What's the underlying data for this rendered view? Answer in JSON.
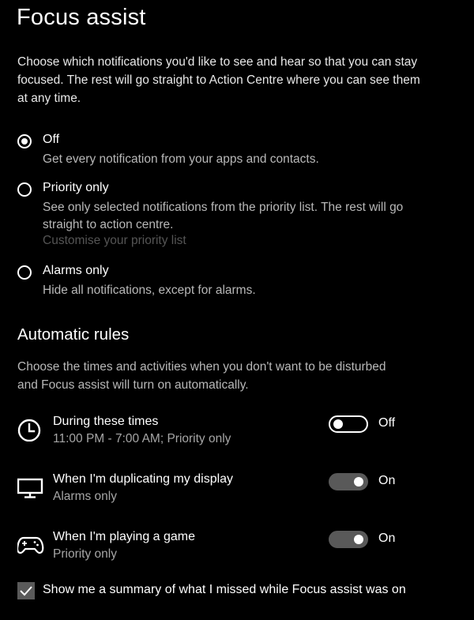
{
  "page": {
    "title": "Focus assist",
    "intro": "Choose which notifications you'd like to see and hear so that you can stay focused. The rest will go straight to Action Centre where you can see them at any time."
  },
  "modes": [
    {
      "label": "Off",
      "description": "Get every notification from your apps and contacts.",
      "selected": true
    },
    {
      "label": "Priority only",
      "description": "See only selected notifications from the priority list. The rest will go straight to action centre.",
      "link": "Customise your priority list",
      "selected": false
    },
    {
      "label": "Alarms only",
      "description": "Hide all notifications, except for alarms.",
      "selected": false
    }
  ],
  "automatic_rules": {
    "heading": "Automatic rules",
    "description": "Choose the times and activities when you don't want to be disturbed and Focus assist will turn on automatically.",
    "rules": [
      {
        "title": "During these times",
        "subtitle": "11:00 PM - 7:00 AM; Priority only",
        "icon": "clock-icon",
        "state": "Off",
        "enabled": false
      },
      {
        "title": "When I'm duplicating my display",
        "subtitle": "Alarms only",
        "icon": "monitor-icon",
        "state": "On",
        "enabled": true
      },
      {
        "title": "When I'm playing a game",
        "subtitle": "Priority only",
        "icon": "gamepad-icon",
        "state": "On",
        "enabled": true
      }
    ]
  },
  "summary_checkbox": {
    "label": "Show me a summary of what I missed while Focus assist was on",
    "checked": true
  },
  "colors": {
    "background": "#000000",
    "text": "#ffffff",
    "secondary_text": "#b8b8b8",
    "disabled_link": "#555555",
    "toggle_on_track": "#595959"
  }
}
